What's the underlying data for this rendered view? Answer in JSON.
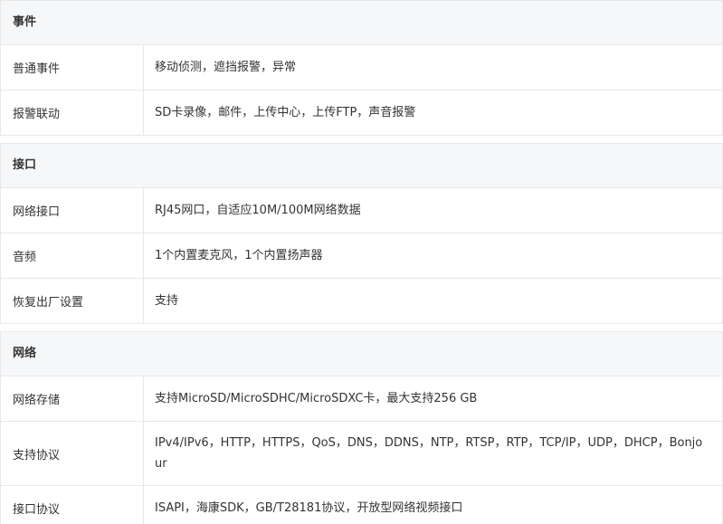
{
  "sections": [
    {
      "title": "事件",
      "rows": [
        {
          "label": "普通事件",
          "value": "移动侦测，遮挡报警，异常"
        },
        {
          "label": "报警联动",
          "value": "SD卡录像，邮件，上传中心，上传FTP，声音报警"
        }
      ]
    },
    {
      "title": "接口",
      "rows": [
        {
          "label": "网络接口",
          "value": "RJ45网口，自适应10M/100M网络数据"
        },
        {
          "label": "音频",
          "value": "1个内置麦克风，1个内置扬声器"
        },
        {
          "label": "恢复出厂设置",
          "value": "支持"
        }
      ]
    },
    {
      "title": "网络",
      "rows": [
        {
          "label": "网络存储",
          "value": "支持MicroSD/MicroSDHC/MicroSDXC卡，最大支持256 GB"
        },
        {
          "label": "支持协议",
          "value": "IPv4/IPv6，HTTP，HTTPS，QoS，DNS，DDNS，NTP，RTSP，RTP，TCP/IP，UDP，DHCP，Bonjour"
        },
        {
          "label": "接口协议",
          "value": "ISAPI，海康SDK，GB/T28181协议，开放型网络视频接口"
        }
      ]
    }
  ]
}
